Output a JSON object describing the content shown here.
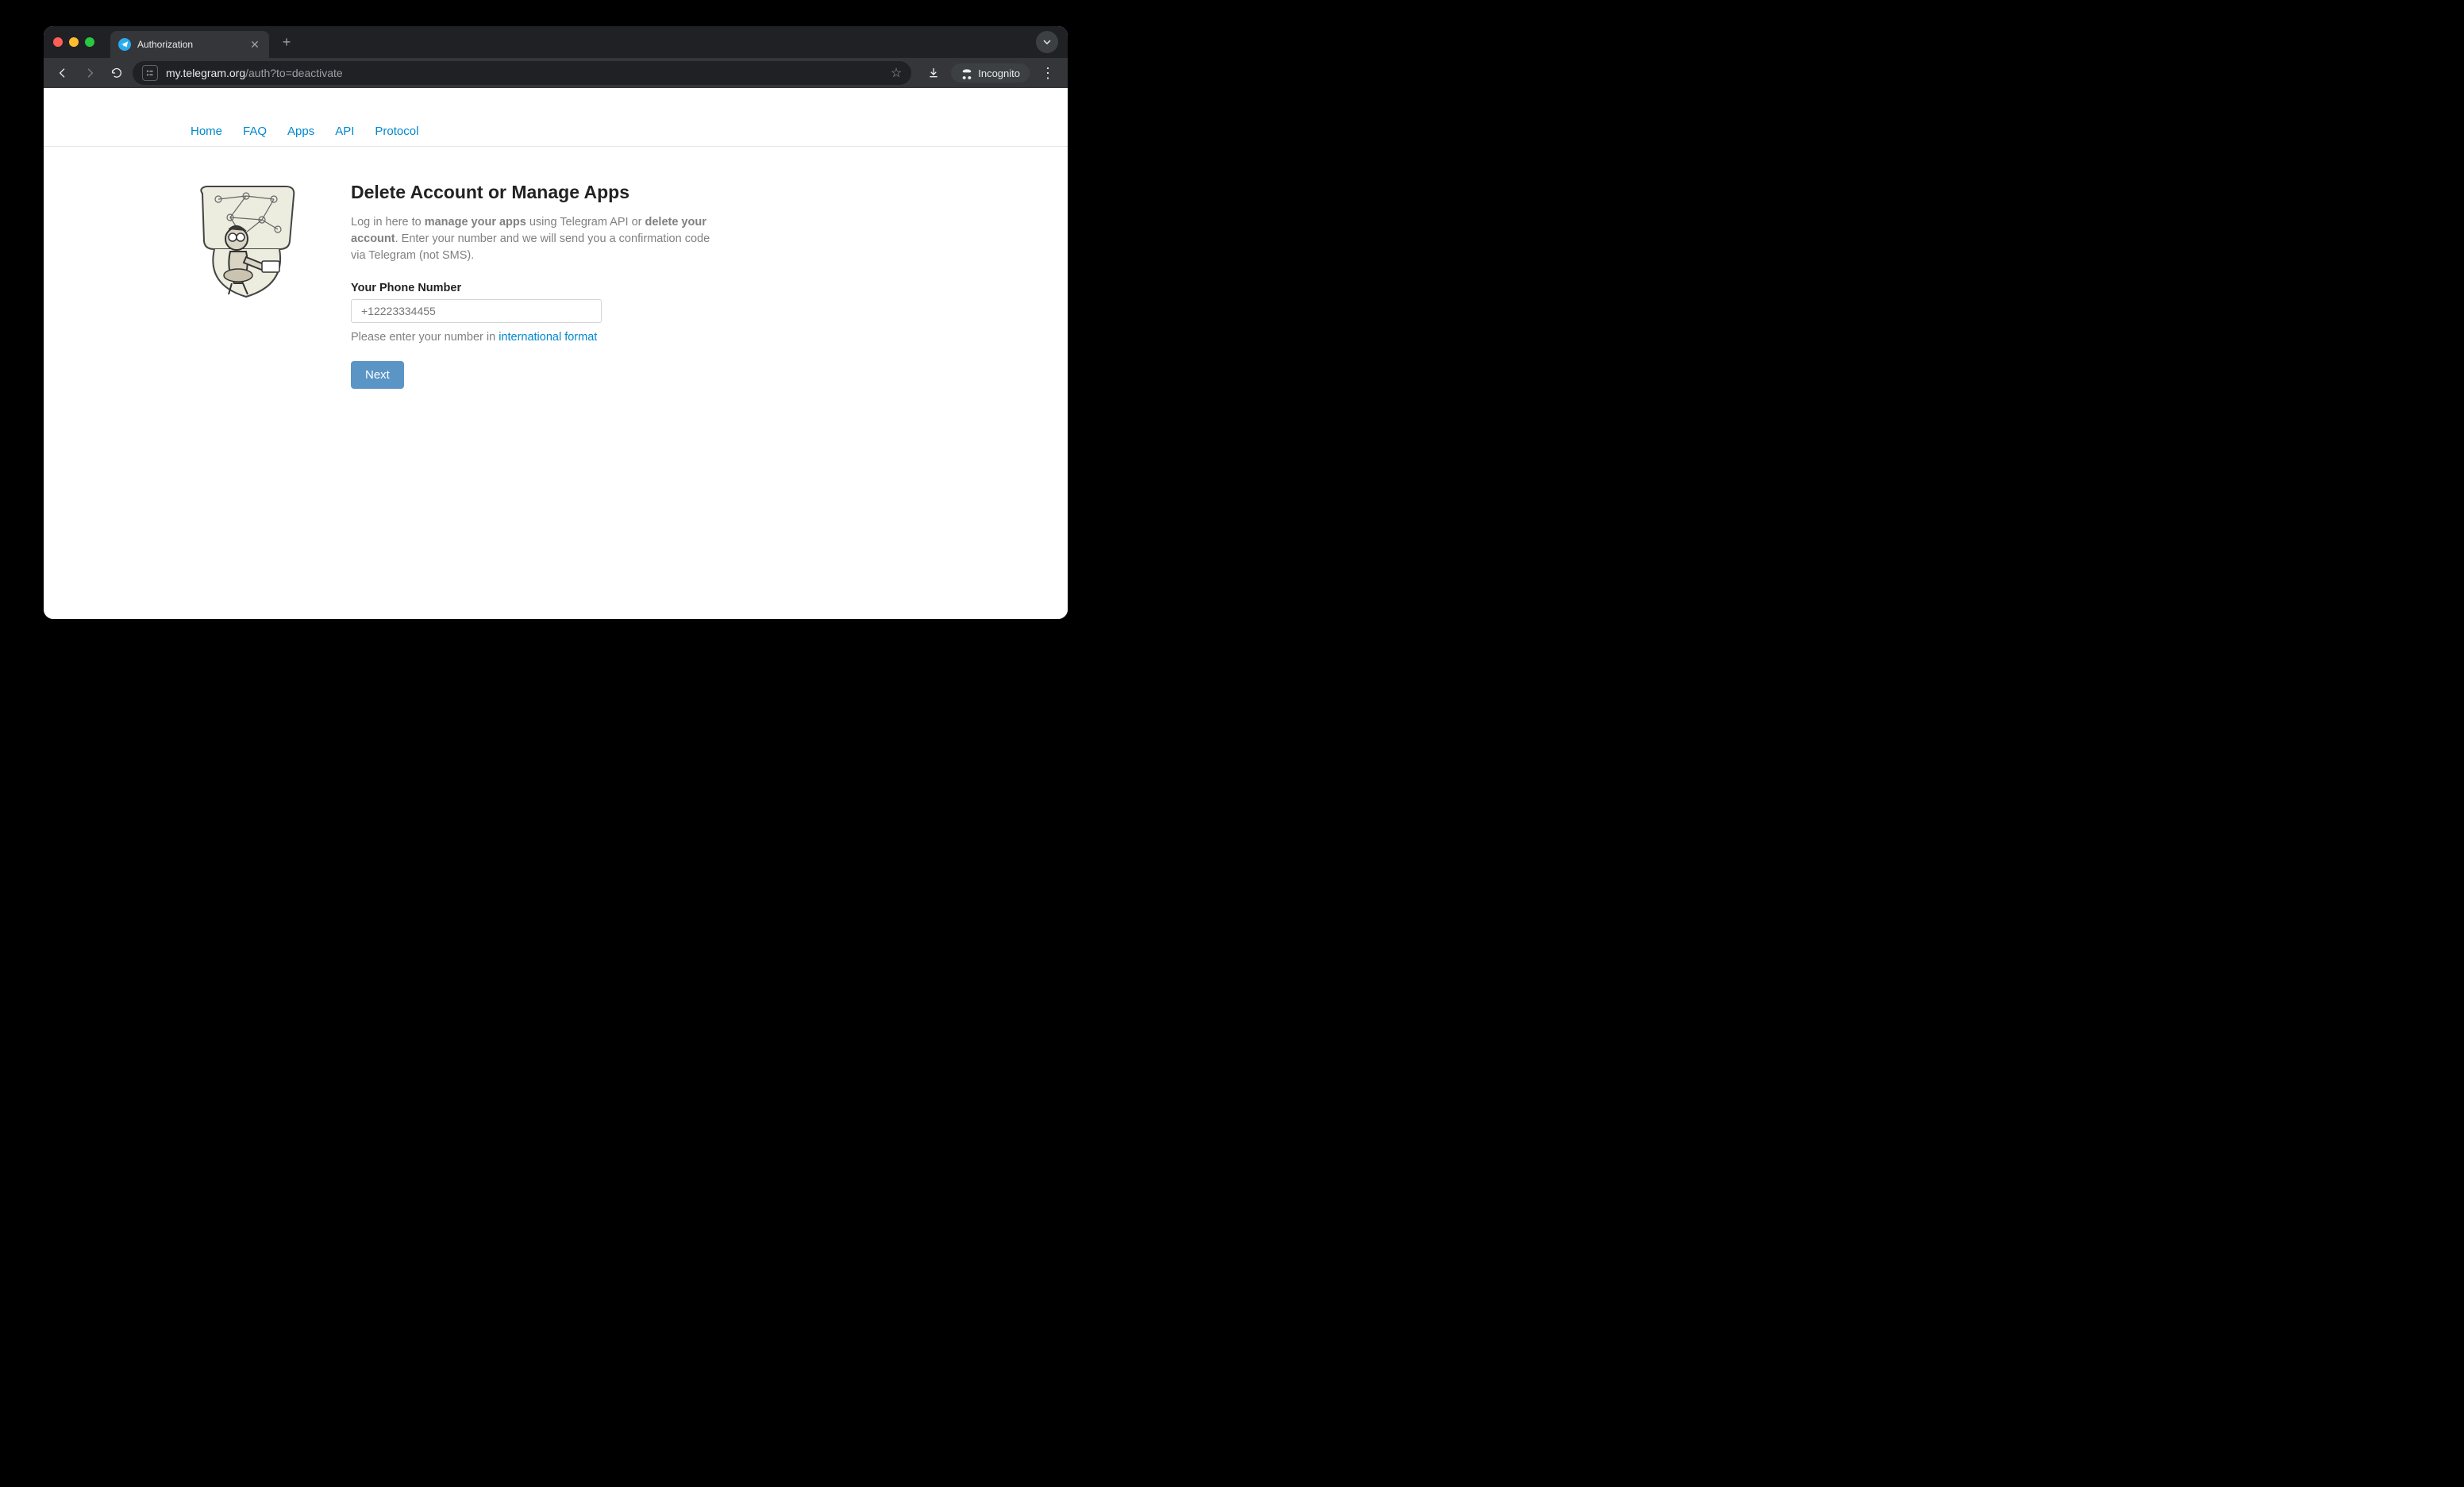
{
  "browser": {
    "tab_title": "Authorization",
    "url_domain": "my.telegram.org",
    "url_path": "/auth?to=deactivate",
    "incognito_label": "Incognito"
  },
  "nav": {
    "items": [
      "Home",
      "FAQ",
      "Apps",
      "API",
      "Protocol"
    ]
  },
  "page": {
    "heading": "Delete Account or Manage Apps",
    "desc_prefix": "Log in here to ",
    "desc_bold1": "manage your apps",
    "desc_mid": " using Telegram API or ",
    "desc_bold2": "delete your account",
    "desc_suffix": ". Enter your number and we will send you a confirmation code via Telegram (not SMS).",
    "phone_label": "Your Phone Number",
    "phone_placeholder": "+12223334455",
    "help_prefix": "Please enter your number in ",
    "help_link": "international format",
    "next_label": "Next"
  }
}
